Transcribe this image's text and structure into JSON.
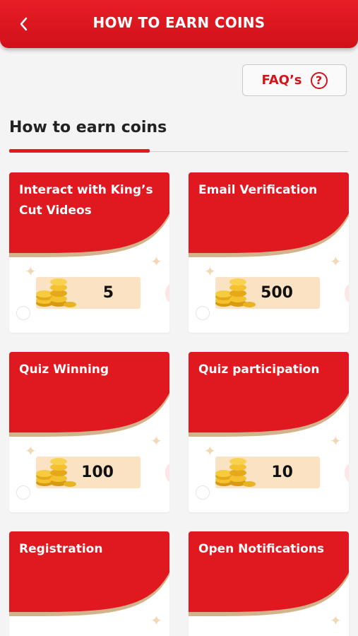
{
  "header": {
    "title": "HOW TO EARN COINS",
    "back_icon": "chevron-left-icon"
  },
  "faq": {
    "label": "FAQ’s",
    "icon": "question-circle-icon",
    "icon_glyph": "?"
  },
  "section": {
    "title": "How to earn coins"
  },
  "colors": {
    "brand_red": "#e01820",
    "coin_box": "#fbe2c2",
    "curve": "#d2b48c"
  },
  "cards": [
    {
      "title": "Interact with King’s Cut Videos",
      "coins": "5"
    },
    {
      "title": "Email Verification",
      "coins": "500"
    },
    {
      "title": "Quiz Winning",
      "coins": "100"
    },
    {
      "title": "Quiz participation",
      "coins": "10"
    },
    {
      "title": "Registration",
      "coins": ""
    },
    {
      "title": "Open Notifications",
      "coins": ""
    }
  ]
}
